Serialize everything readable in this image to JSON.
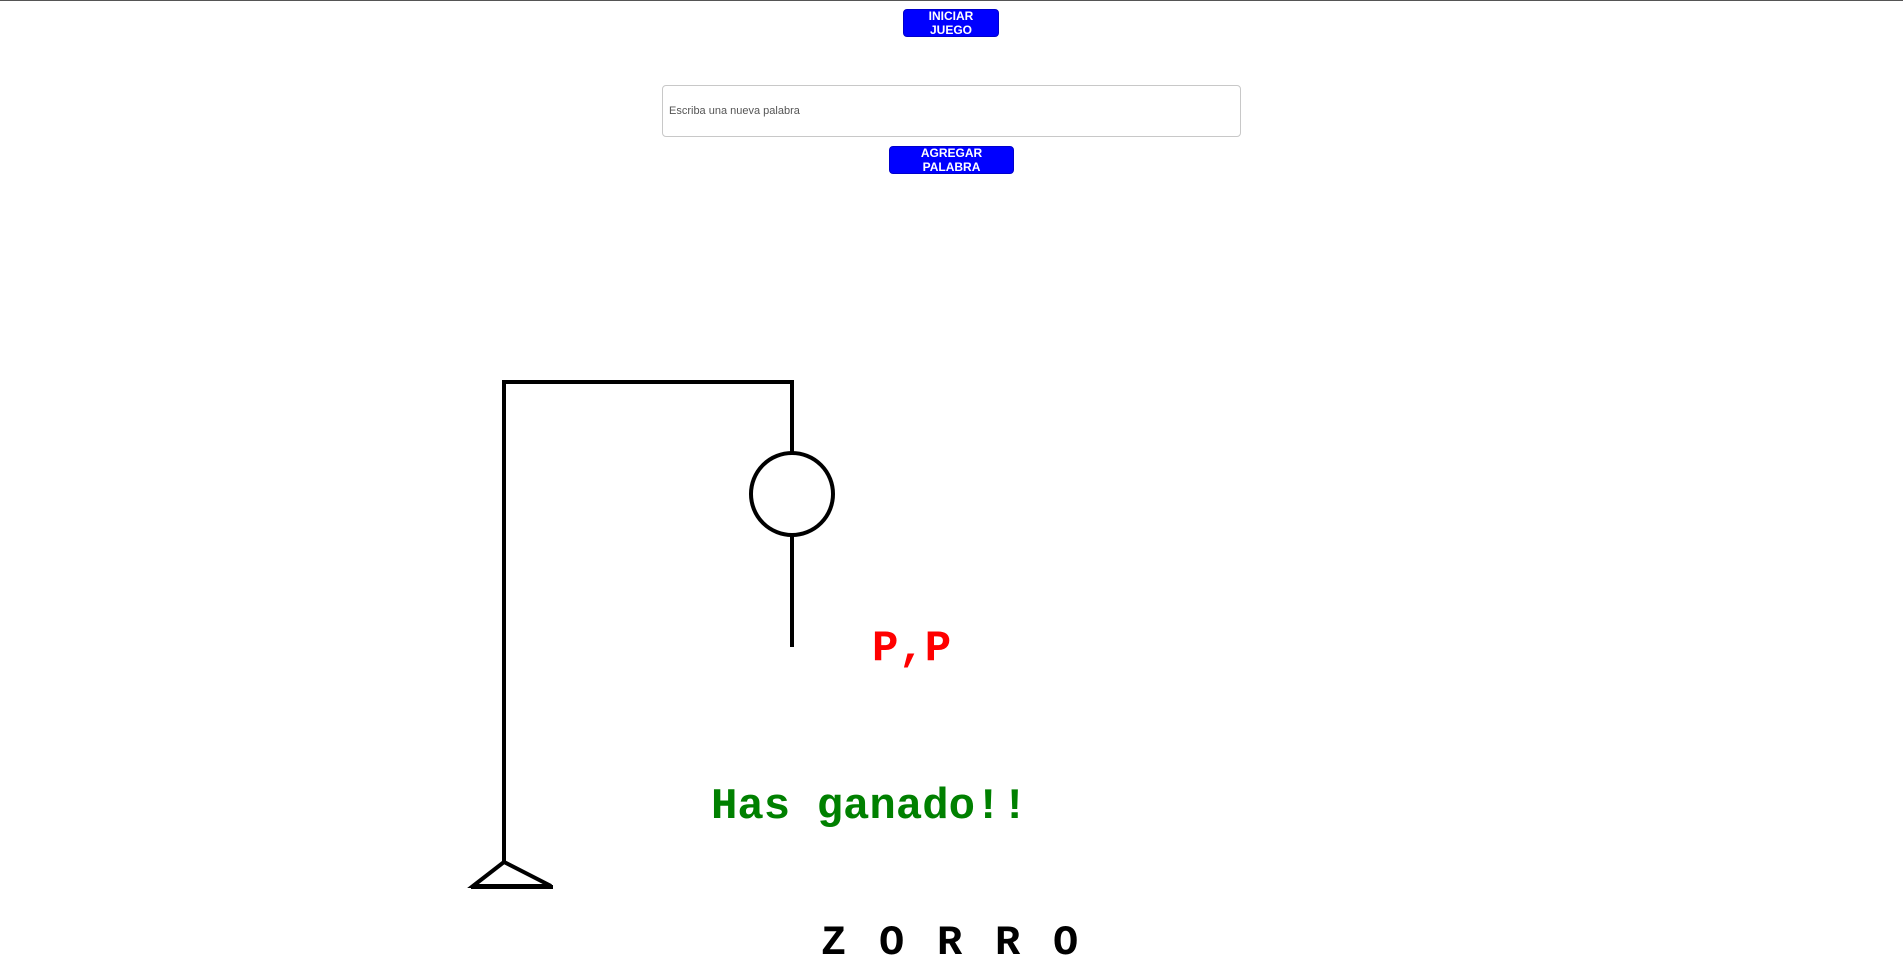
{
  "controls": {
    "start_label": "INICIAR JUEGO",
    "add_label": "AGREGAR PALABRA",
    "new_word_placeholder": "Escriba una nueva palabra",
    "new_word_value": ""
  },
  "game": {
    "wrong_letters": "P,P",
    "result_message": "Has ganado!!",
    "word_letters": [
      "Z",
      "O",
      "R",
      "R",
      "O"
    ],
    "colors": {
      "wrong_letters": "#ff0000",
      "result_message": "#008000",
      "button": "#0000ff"
    }
  }
}
